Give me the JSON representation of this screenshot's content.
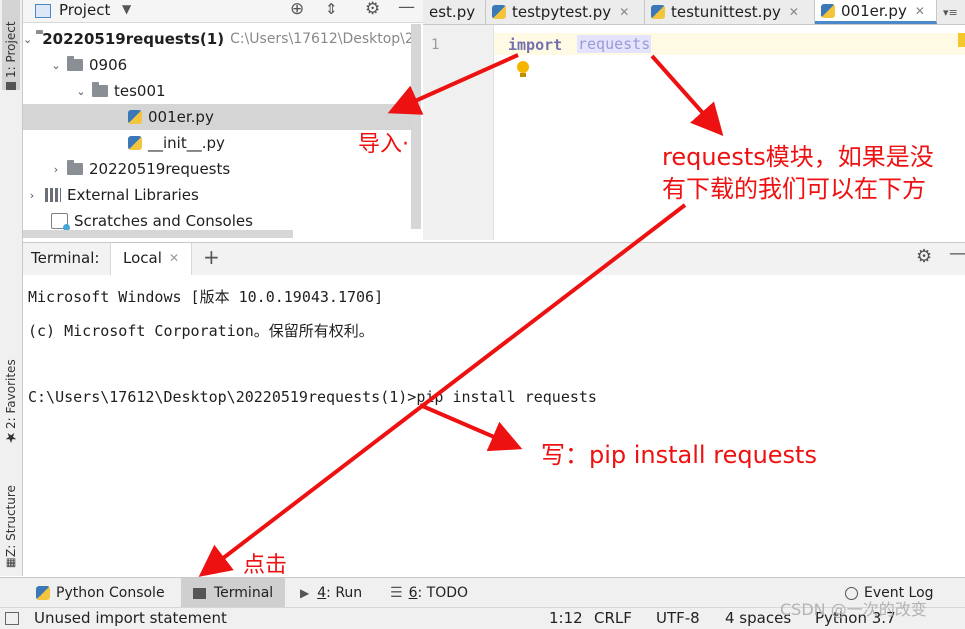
{
  "sidebar_strip": {
    "project_tab": "1: Project",
    "favorites_tab": "2: Favorites",
    "structure_tab": "Z: Structure"
  },
  "project_panel": {
    "title": "Project",
    "tree": [
      {
        "label": "20220519requests(1)",
        "path": "C:\\Users\\17612\\Desktop\\2"
      },
      {
        "label": "0906"
      },
      {
        "label": "tes001"
      },
      {
        "label": "001er.py"
      },
      {
        "label": "__init__.py"
      },
      {
        "label": "20220519requests"
      },
      {
        "label": "External Libraries"
      },
      {
        "label": "Scratches and Consoles"
      }
    ]
  },
  "editor": {
    "tabs": [
      "est.py",
      "testpytest.py",
      "testunittest.py",
      "001er.py"
    ],
    "line_number": "1",
    "code_keyword": "import",
    "code_module": "requests"
  },
  "terminal": {
    "label": "Terminal:",
    "tab": "Local",
    "lines": [
      "Microsoft Windows [版本 10.0.19043.1706]",
      "(c) Microsoft Corporation。保留所有权利。",
      "C:\\Users\\17612\\Desktop\\20220519requests(1)>pip install requests"
    ]
  },
  "bottom_tools": {
    "python_console": "Python Console",
    "terminal": "Terminal",
    "run_num": "4",
    "run": ": Run",
    "todo_num": "6",
    "todo": ": TODO",
    "event_log": "Event Log"
  },
  "status": {
    "message": "Unused import statement",
    "position": "1:12",
    "line_sep": "CRLF",
    "encoding": "UTF-8",
    "indent": "4 spaces",
    "interpreter": "Python 3.7"
  },
  "annotations": {
    "import_note": "导入·",
    "requests_line1": "requests模块，如果是没",
    "requests_line2": "有下载的我们可以在下方",
    "write_note": "写：pip install requests",
    "click_note": "点击"
  },
  "watermark": "CSDN @一次的改变",
  "colors": {
    "annotation": "#ee1111",
    "keyword": "#000080",
    "accent": "#4a88c7"
  }
}
